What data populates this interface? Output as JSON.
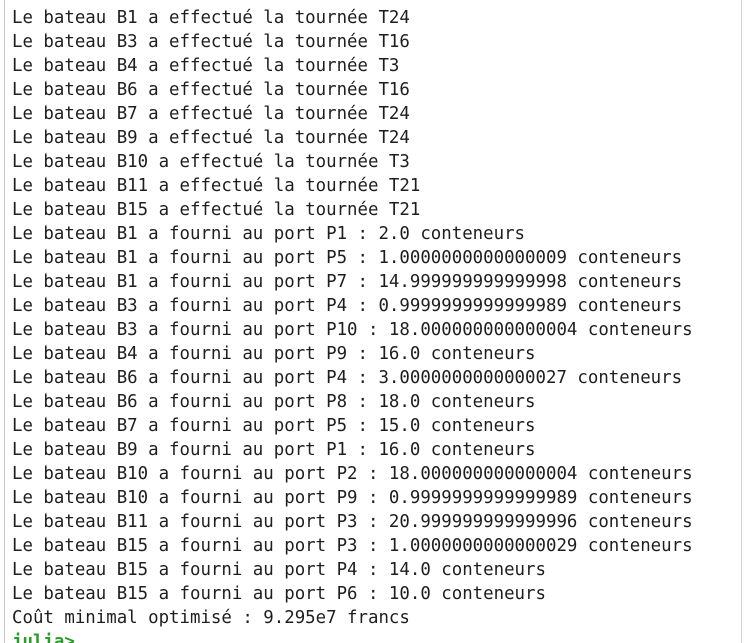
{
  "console": {
    "lines": [
      "Le bateau B1 a effectué la tournée T24",
      "Le bateau B3 a effectué la tournée T16",
      "Le bateau B4 a effectué la tournée T3",
      "Le bateau B6 a effectué la tournée T16",
      "Le bateau B7 a effectué la tournée T24",
      "Le bateau B9 a effectué la tournée T24",
      "Le bateau B10 a effectué la tournée T3",
      "Le bateau B11 a effectué la tournée T21",
      "Le bateau B15 a effectué la tournée T21",
      "Le bateau B1 a fourni au port P1 : 2.0 conteneurs",
      "Le bateau B1 a fourni au port P5 : 1.0000000000000009 conteneurs",
      "Le bateau B1 a fourni au port P7 : 14.999999999999998 conteneurs",
      "Le bateau B3 a fourni au port P4 : 0.9999999999999989 conteneurs",
      "Le bateau B3 a fourni au port P10 : 18.000000000000004 conteneurs",
      "Le bateau B4 a fourni au port P9 : 16.0 conteneurs",
      "Le bateau B6 a fourni au port P4 : 3.0000000000000027 conteneurs",
      "Le bateau B6 a fourni au port P8 : 18.0 conteneurs",
      "Le bateau B7 a fourni au port P5 : 15.0 conteneurs",
      "Le bateau B9 a fourni au port P1 : 16.0 conteneurs",
      "Le bateau B10 a fourni au port P2 : 18.000000000000004 conteneurs",
      "Le bateau B10 a fourni au port P9 : 0.9999999999999989 conteneurs",
      "Le bateau B11 a fourni au port P3 : 20.999999999999996 conteneurs",
      "Le bateau B15 a fourni au port P3 : 1.0000000000000029 conteneurs",
      "Le bateau B15 a fourni au port P4 : 14.0 conteneurs",
      "Le bateau B15 a fourni au port P6 : 10.0 conteneurs",
      "Coût minimal optimisé : 9.295e7 francs"
    ],
    "prompt": "julia>"
  },
  "colors": {
    "text": "#1e1e1e",
    "prompt": "#2e9a2e",
    "background": "#ffffff"
  }
}
